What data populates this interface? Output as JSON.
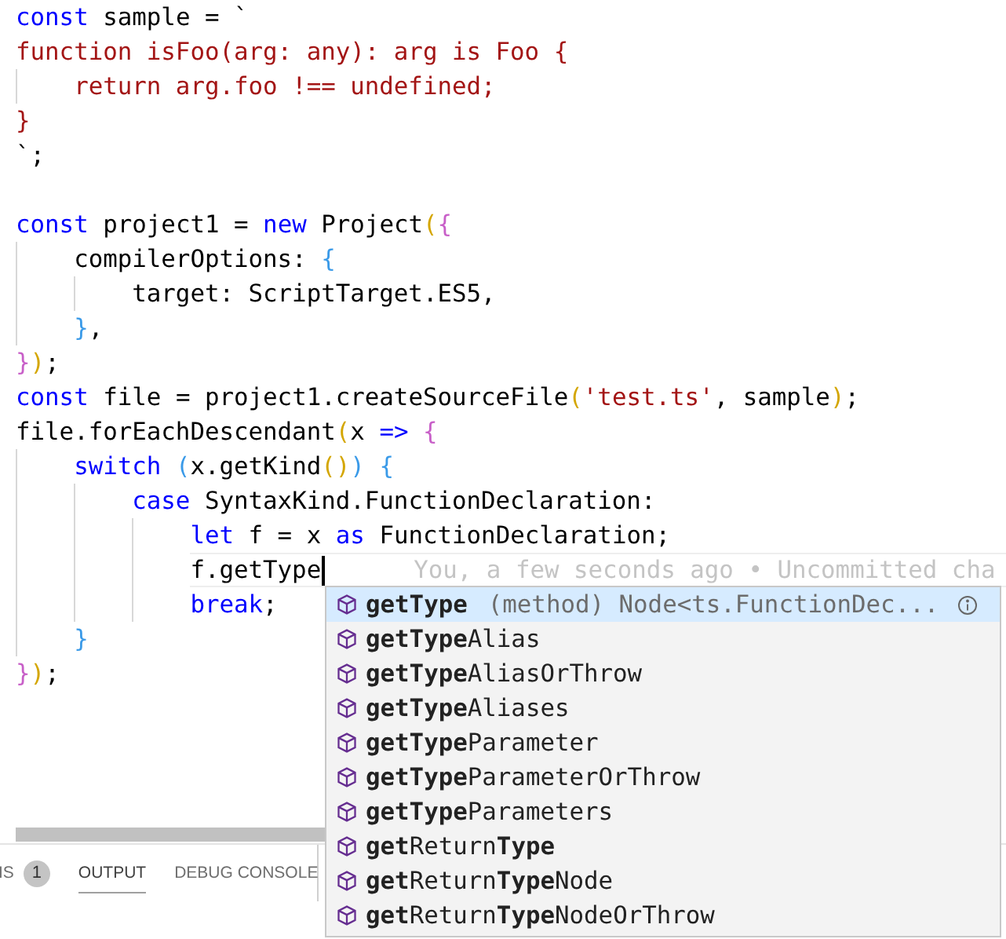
{
  "editor": {
    "lines": [
      {
        "current": false,
        "tokens": [
          {
            "text": "const",
            "kind": "keyword"
          },
          {
            "text": " sample = `",
            "kind": "text"
          }
        ]
      },
      {
        "current": false,
        "tokens": [
          {
            "text": "function isFoo(arg: any): arg is Foo {",
            "kind": "string"
          }
        ],
        "children": [
          {
            "current": false,
            "tokens": [
              {
                "text": "return arg.foo !== undefined;",
                "kind": "string"
              }
            ]
          }
        ]
      },
      {
        "current": false,
        "tokens": [
          {
            "text": "}",
            "kind": "string"
          }
        ]
      },
      {
        "current": false,
        "tokens": [
          {
            "text": "`;",
            "kind": "text"
          }
        ]
      },
      {
        "current": false
      },
      {
        "current": false,
        "tokens": [
          {
            "text": "const",
            "kind": "keyword"
          },
          {
            "text": " project1 = ",
            "kind": "text"
          },
          {
            "text": "new",
            "kind": "keyword"
          },
          {
            "text": " Project",
            "kind": "text"
          },
          {
            "text": "(",
            "kind": "bracket1"
          },
          {
            "text": "{",
            "kind": "bracket2"
          }
        ],
        "children": [
          {
            "current": false,
            "tokens": [
              {
                "text": "compilerOptions: ",
                "kind": "text"
              },
              {
                "text": "{",
                "kind": "bracket3"
              }
            ],
            "children": [
              {
                "current": false,
                "tokens": [
                  {
                    "text": "target: ScriptTarget.ES5,",
                    "kind": "text"
                  }
                ]
              }
            ]
          },
          {
            "current": false,
            "tokens": [
              {
                "text": "}",
                "kind": "bracket3"
              },
              {
                "text": ",",
                "kind": "text"
              }
            ]
          }
        ]
      },
      {
        "current": false,
        "tokens": [
          {
            "text": "}",
            "kind": "bracket2"
          },
          {
            "text": ")",
            "kind": "bracket1"
          },
          {
            "text": ";",
            "kind": "text"
          }
        ]
      },
      {
        "current": false,
        "tokens": [
          {
            "text": "const",
            "kind": "keyword"
          },
          {
            "text": " file = project1.createSourceFile",
            "kind": "text"
          },
          {
            "text": "(",
            "kind": "bracket1"
          },
          {
            "text": "'test.ts'",
            "kind": "string"
          },
          {
            "text": ", sample",
            "kind": "text"
          },
          {
            "text": ")",
            "kind": "bracket1"
          },
          {
            "text": ";",
            "kind": "text"
          }
        ]
      },
      {
        "current": false,
        "tokens": [
          {
            "text": "file.forEachDescendant",
            "kind": "text"
          },
          {
            "text": "(",
            "kind": "bracket1"
          },
          {
            "text": "x ",
            "kind": "text"
          },
          {
            "text": "=>",
            "kind": "keyword"
          },
          {
            "text": " {",
            "kind": "bracket2"
          }
        ],
        "children": [
          {
            "current": false,
            "tokens": [
              {
                "text": "switch",
                "kind": "keyword"
              },
              {
                "text": " (",
                "kind": "bracket3"
              },
              {
                "text": "x.getKind",
                "kind": "text"
              },
              {
                "text": "()",
                "kind": "bracket1"
              },
              {
                "text": ")",
                "kind": "bracket3"
              },
              {
                "text": " {",
                "kind": "bracket3"
              }
            ],
            "children": [
              {
                "current": false,
                "tokens": [
                  {
                    "text": "case",
                    "kind": "keyword"
                  },
                  {
                    "text": " SyntaxKind.FunctionDeclaration:",
                    "kind": "text"
                  }
                ],
                "children": [
                  {
                    "current": false,
                    "tokens": [
                      {
                        "text": "let",
                        "kind": "keyword"
                      },
                      {
                        "text": " f = x ",
                        "kind": "text"
                      },
                      {
                        "text": "as",
                        "kind": "keyword"
                      },
                      {
                        "text": " FunctionDeclaration;",
                        "kind": "text"
                      }
                    ]
                  },
                  {
                    "current": true,
                    "tokens": [
                      {
                        "text": "f.getType",
                        "kind": "text"
                      }
                    ],
                    "blame": "You, a few seconds ago • Uncommitted cha"
                  },
                  {
                    "current": false,
                    "tokens": [
                      {
                        "text": "break",
                        "kind": "keyword"
                      },
                      {
                        "text": ";",
                        "kind": "text"
                      }
                    ]
                  }
                ]
              }
            ]
          },
          {
            "current": false,
            "tokens": [
              {
                "text": "}",
                "kind": "bracket3"
              }
            ]
          }
        ]
      },
      {
        "current": false,
        "tokens": [
          {
            "text": "}",
            "kind": "bracket2"
          },
          {
            "text": ")",
            "kind": "bracket1"
          },
          {
            "text": ";",
            "kind": "text"
          }
        ]
      }
    ]
  },
  "suggestions": [
    {
      "label": "**getType**",
      "detail": "(method) Node<ts.FunctionDec...",
      "selected": true
    },
    {
      "label": "**getType**Alias",
      "selected": false
    },
    {
      "label": "**getType**AliasOrThrow",
      "selected": false
    },
    {
      "label": "**getType**Aliases",
      "selected": false
    },
    {
      "label": "**getType**Parameter",
      "selected": false
    },
    {
      "label": "**getType**ParameterOrThrow",
      "selected": false
    },
    {
      "label": "**getType**Parameters",
      "selected": false
    },
    {
      "label": "**get**Return**Type**",
      "selected": false
    },
    {
      "label": "**get**Return**Type**Node",
      "selected": false
    },
    {
      "label": "**get**Return**Type**NodeOrThrow",
      "selected": false
    }
  ],
  "panel": {
    "tabs": [
      {
        "label": "IS",
        "badge": "1",
        "selected": false
      },
      {
        "label": "OUTPUT",
        "selected": true
      },
      {
        "label": "DEBUG CONSOLE",
        "selected": false
      }
    ]
  }
}
